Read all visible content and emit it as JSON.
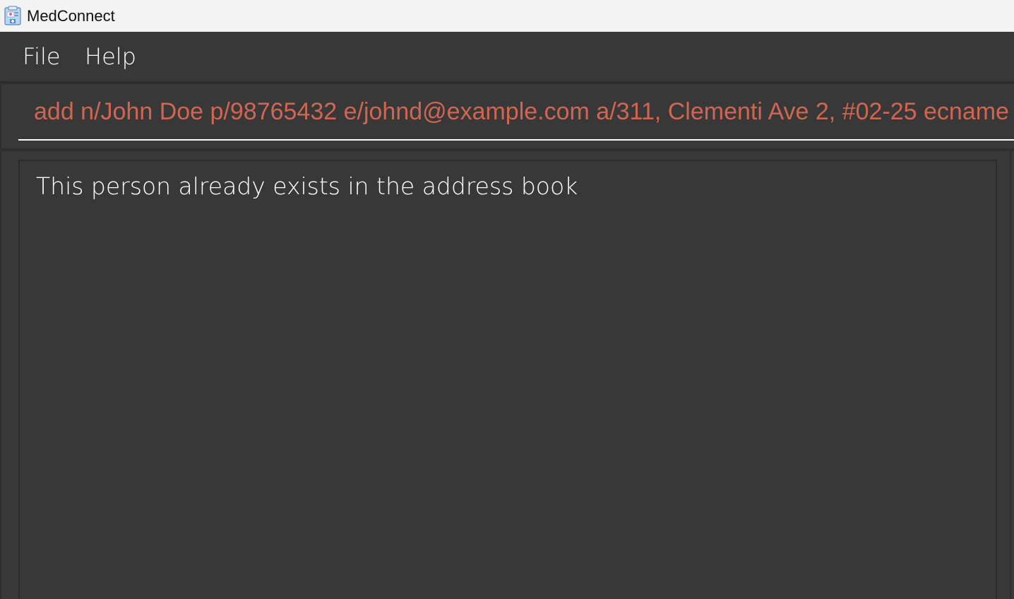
{
  "window": {
    "title": "MedConnect",
    "icon": "medconnect-app-icon"
  },
  "menu": {
    "items": [
      {
        "label": "File"
      },
      {
        "label": "Help"
      }
    ]
  },
  "command_box": {
    "value": "add n/John Doe p/98765432 e/johnd@example.com a/311, Clementi Ave 2, #02-25 ecname",
    "text_color": "#d06651"
  },
  "result_display": {
    "message": "This person already exists in the address book"
  },
  "colors": {
    "background": "#383838",
    "titlebar": "#f3f3f3",
    "error_text": "#d06651"
  }
}
